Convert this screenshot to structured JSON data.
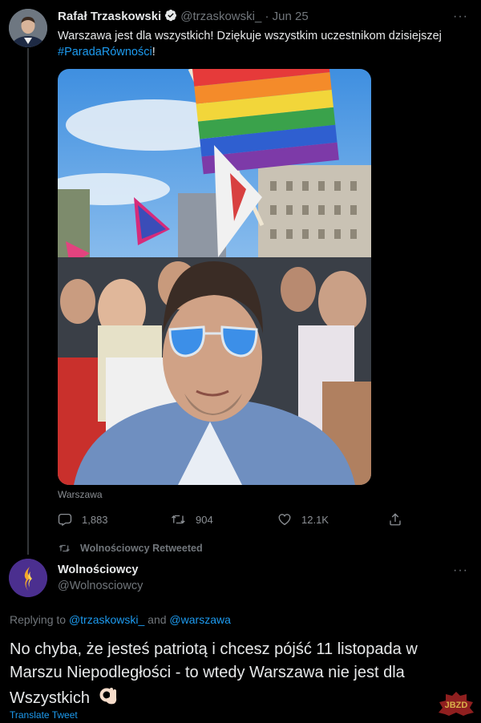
{
  "tweet1": {
    "author_name": "Rafał Trzaskowski",
    "handle": "@trzaskowski_",
    "separator": "·",
    "date": "Jun 25",
    "more_label": "···",
    "text_plain": "Warszawa jest dla wszystkich! Dziękuje wszystkim uczestnikom dzisiejszej",
    "hashtag": "#ParadaRówności",
    "text_end": "!",
    "photo_caption": "Warszawa",
    "stats": {
      "replies": "1,883",
      "retweets": "904",
      "likes": "12.1K"
    }
  },
  "retweet_context": {
    "label": "Wolnościowcy Retweeted"
  },
  "tweet2": {
    "author_name": "Wolnościowcy",
    "handle": "@Wolnosciowcy",
    "more_label": "···",
    "replying_prefix": "Replying to",
    "replying_user1": "@trzaskowski_",
    "replying_and": "and",
    "replying_user2": "@warszawa",
    "text": "No chyba, że jesteś patriotą i chcesz pójść 11 listopada w Marszu Niepodległości - to wtedy Warszawa nie jest dla Wszystkich",
    "emoji": "👌🏻",
    "translate_label": "Translate Tweet"
  },
  "watermark": {
    "text": "JBZD"
  },
  "colors": {
    "accent": "#1d9bf0",
    "muted": "#71767b",
    "background": "#000000"
  },
  "icons": [
    "verified-badge-icon",
    "reply-icon",
    "retweet-icon",
    "like-icon",
    "share-icon",
    "more-icon",
    "flame-logo-icon",
    "ok-hand-emoji"
  ]
}
